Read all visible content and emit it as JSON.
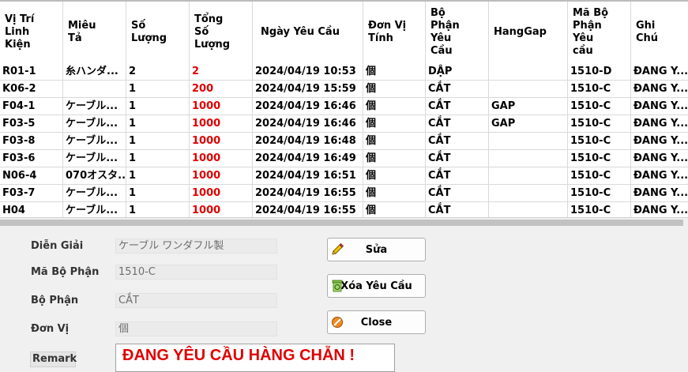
{
  "columns": [
    {
      "label": "Vị Trí\nLinh\nKiện"
    },
    {
      "label": "Miêu\nTả"
    },
    {
      "label": "Số\nLượng"
    },
    {
      "label": "Tổng\nSố\nLượng"
    },
    {
      "label": "Ngày Yêu Cầu"
    },
    {
      "label": "Đơn Vị\nTính"
    },
    {
      "label": "Bộ\nPhận\nYêu\nCầu"
    },
    {
      "label": "HangGap"
    },
    {
      "label": "Mã Bộ\nPhận\nYêu\ncầu"
    },
    {
      "label": "Ghi\nChú"
    }
  ],
  "rows": [
    {
      "pos": "R01-1",
      "desc": "糸ハンダ...",
      "qty": "2",
      "total": "2",
      "date": "2024/04/19 10:53",
      "unit": "個",
      "dept": "DẬP",
      "gap": "",
      "code": "1510-D",
      "note": "ĐANG Y..."
    },
    {
      "pos": "K06-2",
      "desc": "",
      "qty": "1",
      "total": "200",
      "date": "2024/04/19 15:59",
      "unit": "個",
      "dept": "CẮT",
      "gap": "",
      "code": "1510-C",
      "note": "ĐANG Y..."
    },
    {
      "pos": "F04-1",
      "desc": "ケーブル...",
      "qty": "1",
      "total": "1000",
      "date": "2024/04/19 16:46",
      "unit": "個",
      "dept": "CẮT",
      "gap": "GAP",
      "code": "1510-C",
      "note": "ĐANG Y..."
    },
    {
      "pos": "F03-5",
      "desc": "ケーブル...",
      "qty": "1",
      "total": "1000",
      "date": "2024/04/19 16:46",
      "unit": "個",
      "dept": "CẮT",
      "gap": "GAP",
      "code": "1510-C",
      "note": "ĐANG Y..."
    },
    {
      "pos": "F03-8",
      "desc": "ケーブル...",
      "qty": "1",
      "total": "1000",
      "date": "2024/04/19 16:48",
      "unit": "個",
      "dept": "CẮT",
      "gap": "",
      "code": "1510-C",
      "note": "ĐANG Y..."
    },
    {
      "pos": "F03-6",
      "desc": "ケーブル...",
      "qty": "1",
      "total": "1000",
      "date": "2024/04/19 16:49",
      "unit": "個",
      "dept": "CẮT",
      "gap": "",
      "code": "1510-C",
      "note": "ĐANG Y..."
    },
    {
      "pos": "N06-4",
      "desc": "070オスタ...",
      "qty": "1",
      "total": "1000",
      "date": "2024/04/19 16:51",
      "unit": "個",
      "dept": "CẮT",
      "gap": "",
      "code": "1510-C",
      "note": "ĐANG Y..."
    },
    {
      "pos": "F03-7",
      "desc": "ケーブル...",
      "qty": "1",
      "total": "1000",
      "date": "2024/04/19 16:55",
      "unit": "個",
      "dept": "CẮT",
      "gap": "",
      "code": "1510-C",
      "note": "ĐANG Y..."
    },
    {
      "pos": "H04",
      "desc": "ケーブル...",
      "qty": "1",
      "total": "1000",
      "date": "2024/04/19 16:55",
      "unit": "個",
      "dept": "CẮT",
      "gap": "",
      "code": "1510-C",
      "note": "ĐANG Y..."
    }
  ],
  "detail": {
    "dien_giai_label": "Diễn Giải",
    "dien_giai_value": "ケーブル ワンダフル製",
    "ma_bo_phan_label": "Mã Bộ Phận",
    "ma_bo_phan_value": "1510-C",
    "bo_phan_label": "Bộ Phận",
    "bo_phan_value": "CẮT",
    "don_vi_label": "Đơn Vị",
    "don_vi_value": "個",
    "remark_label": "Remark",
    "remark_value": "ĐANG YÊU CẦU HÀNG CHẴN !"
  },
  "buttons": {
    "edit": "Sửa",
    "delete": "Xóa Yêu Cầu",
    "close": "Close"
  },
  "icons": {
    "edit": "pencil-icon",
    "delete": "recycle-bin-icon",
    "close": "cancel-icon"
  },
  "colors": {
    "total_qty": "#e00000",
    "remark_text": "#e00000"
  }
}
